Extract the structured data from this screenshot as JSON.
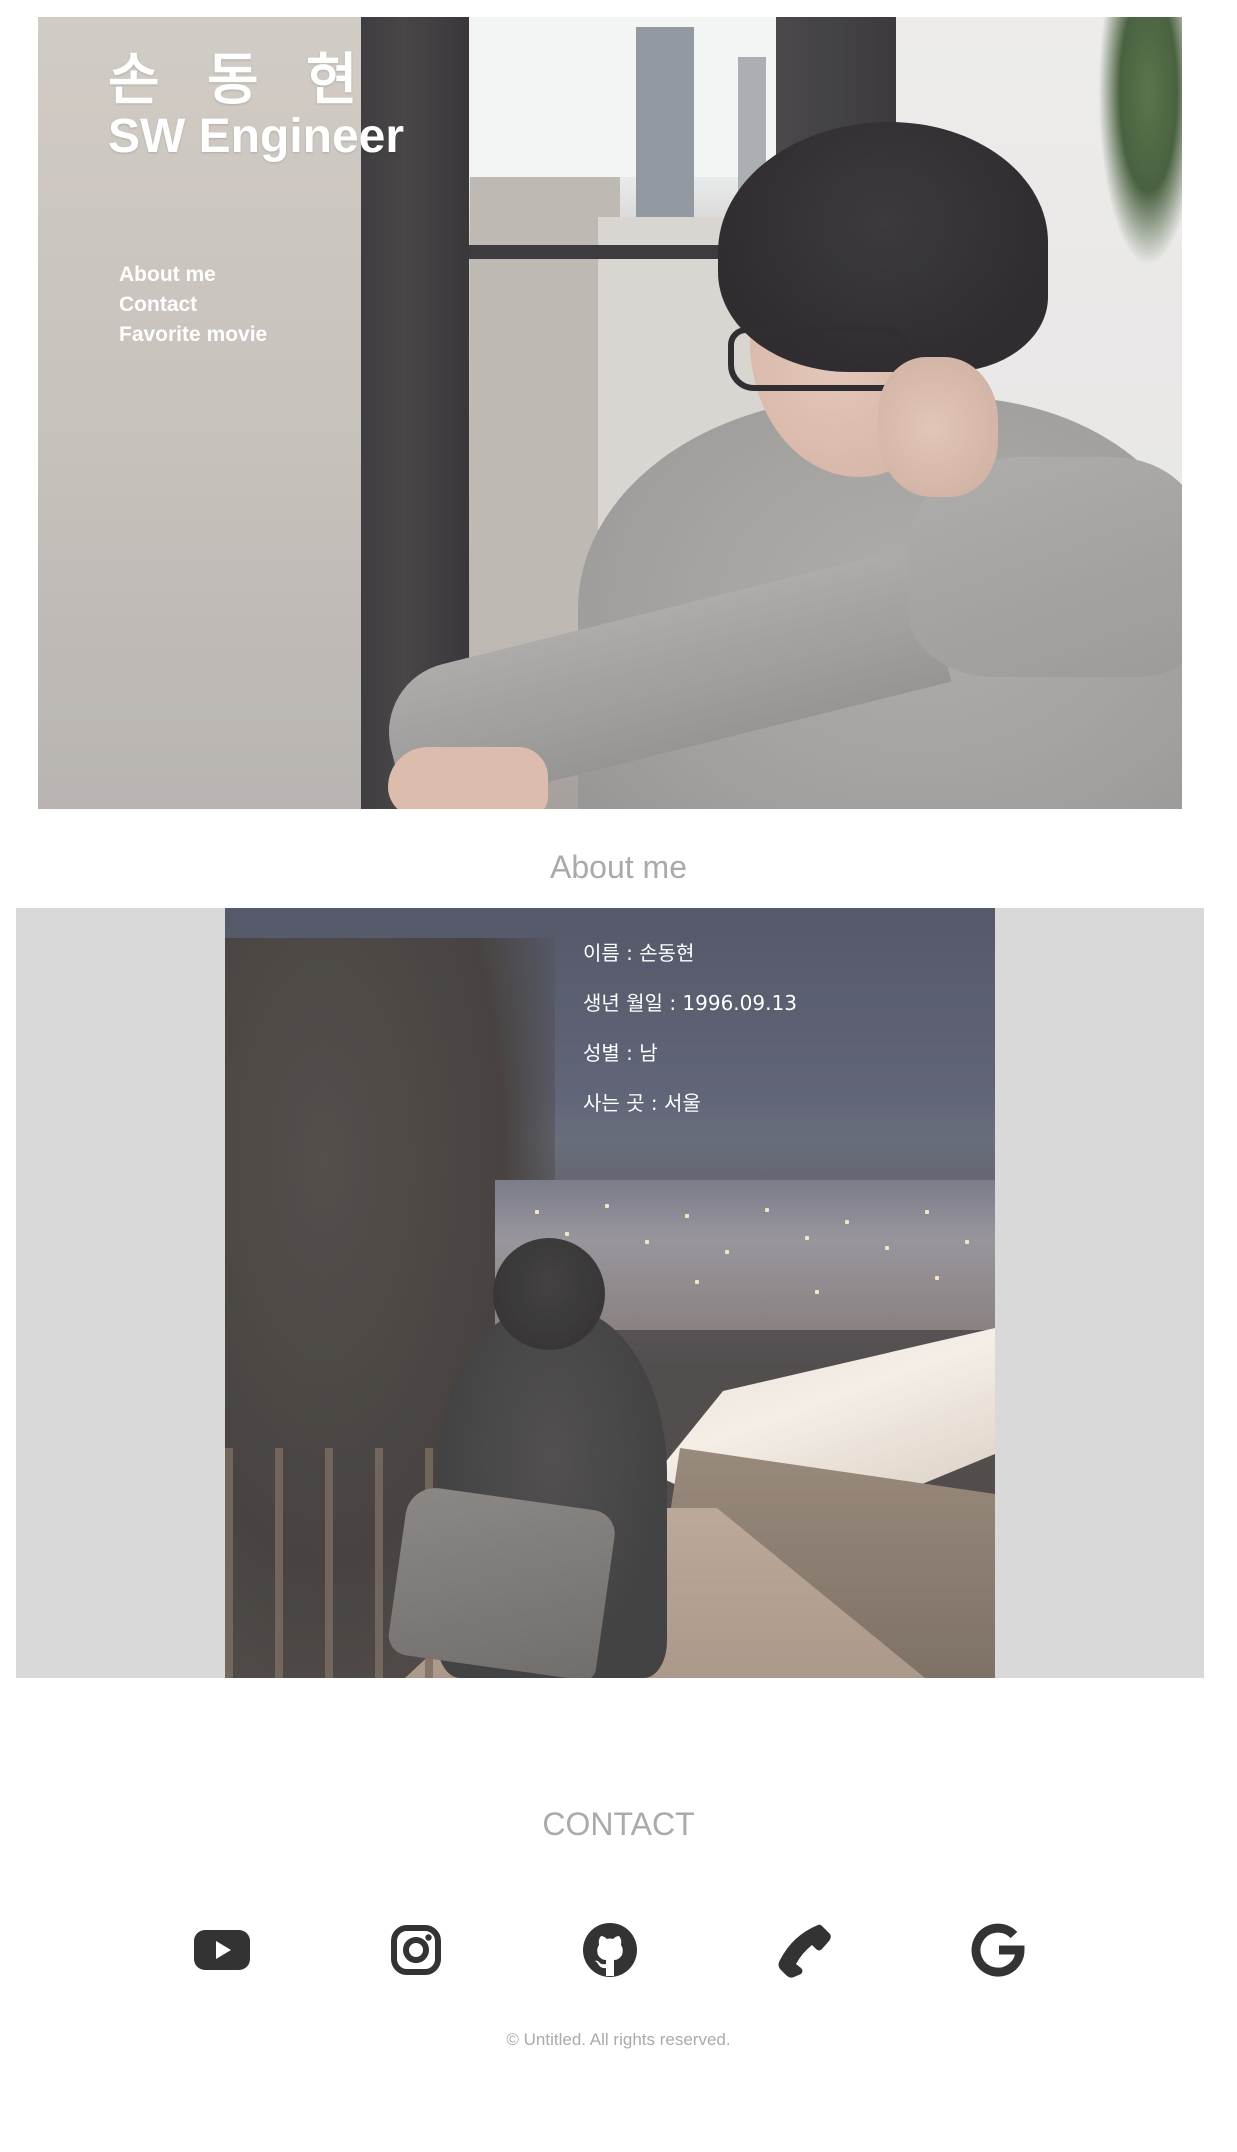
{
  "hero": {
    "name": "손 동 현",
    "role": "SW Engineer",
    "nav": [
      {
        "label": "About me"
      },
      {
        "label": "Contact"
      },
      {
        "label": "Favorite movie"
      }
    ]
  },
  "about": {
    "title": "About me",
    "info": [
      "이름 : 손동현",
      "생년 월일 : 1996.09.13",
      "성별 : 남",
      "사는 곳 : 서울"
    ]
  },
  "contact": {
    "title": "CONTACT",
    "icons": [
      "youtube-icon",
      "instagram-icon",
      "github-icon",
      "phone-icon",
      "google-icon"
    ],
    "icon_color": "#333333"
  },
  "footer": {
    "copyright": "© Untitled. All rights reserved."
  }
}
